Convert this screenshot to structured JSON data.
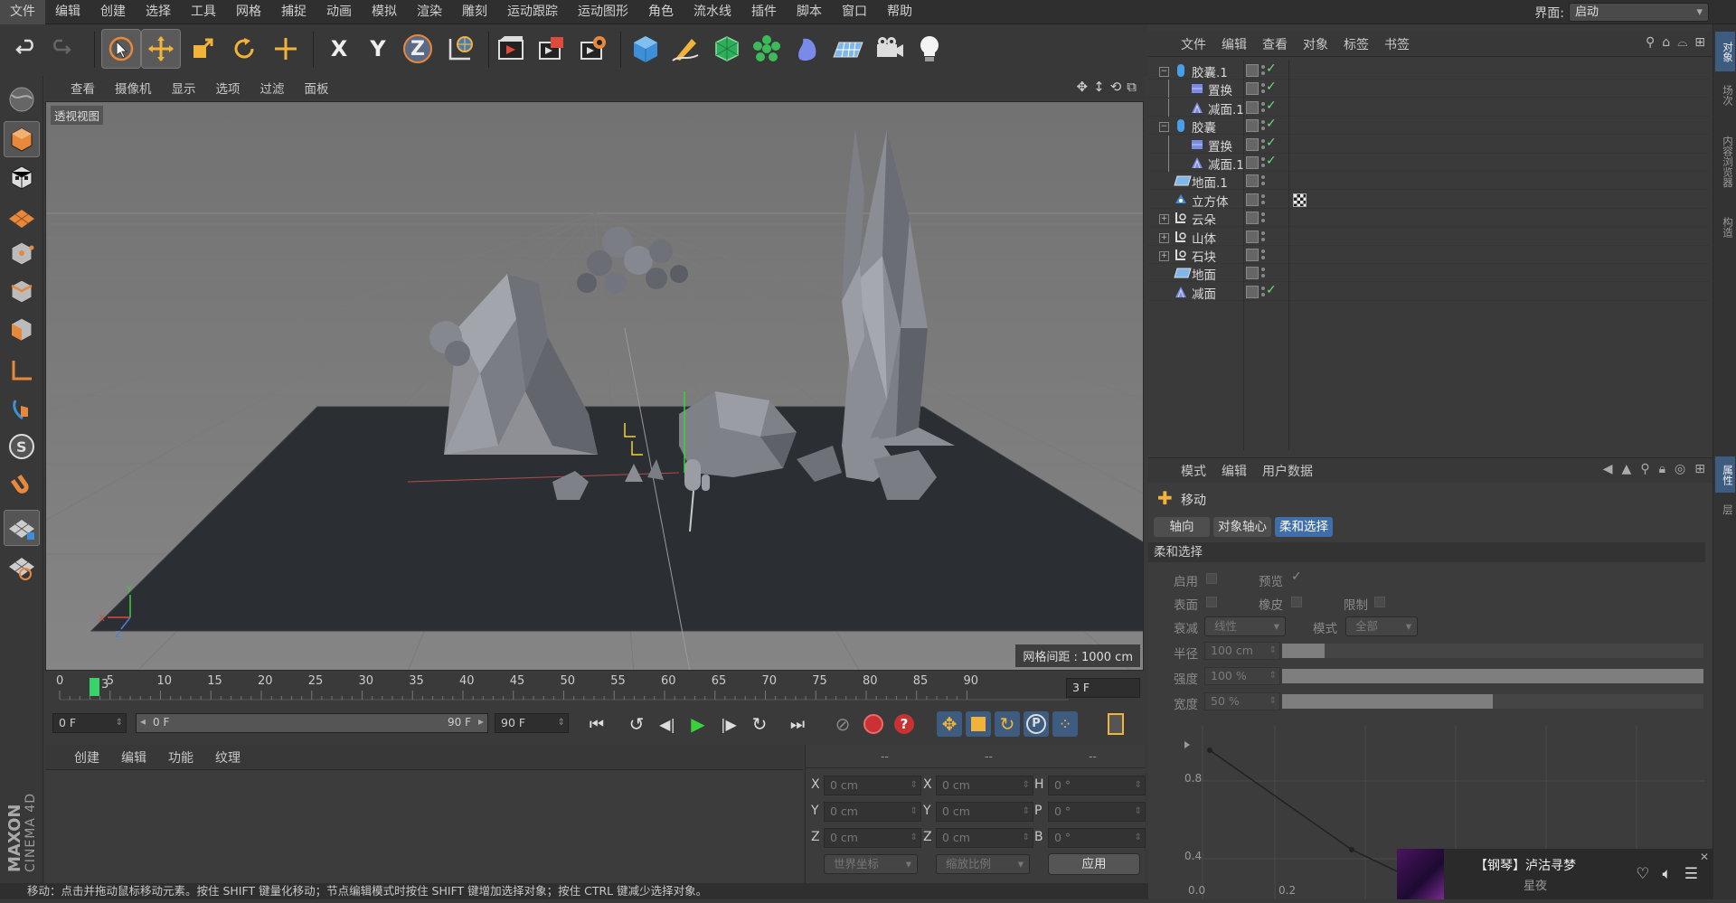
{
  "menubar": {
    "items": [
      "文件",
      "编辑",
      "创建",
      "选择",
      "工具",
      "网格",
      "捕捉",
      "动画",
      "模拟",
      "渲染",
      "雕刻",
      "运动跟踪",
      "运动图形",
      "角色",
      "流水线",
      "插件",
      "脚本",
      "窗口",
      "帮助"
    ],
    "layout_label": "界面:",
    "layout_value": "启动"
  },
  "toolbar": {
    "icons": [
      "undo-icon",
      "redo-icon",
      "live-select-icon",
      "move-icon",
      "scale-icon",
      "rotate-icon",
      "recent-tool-icon",
      "x-axis-icon",
      "y-axis-icon",
      "z-axis-icon",
      "coordinate-system-icon",
      "render-view-icon",
      "render-picture-viewer-icon",
      "render-settings-icon",
      "cube-primitive-icon",
      "pen-spline-icon",
      "subdivision-icon",
      "cloner-icon",
      "deformer-icon",
      "floor-icon",
      "camera-icon",
      "light-icon"
    ],
    "axis_x": "X",
    "axis_y": "Y",
    "axis_z": "Z"
  },
  "viewport": {
    "menu": [
      "查看",
      "摄像机",
      "显示",
      "选项",
      "过滤",
      "面板"
    ],
    "label": "透视视图",
    "grid_spacing": "网格间距 : 1000 cm"
  },
  "timeline": {
    "ticks": [
      "0",
      "5",
      "10",
      "15",
      "20",
      "25",
      "30",
      "35",
      "40",
      "45",
      "50",
      "55",
      "60",
      "65",
      "70",
      "75",
      "80",
      "85",
      "90"
    ],
    "current_frame_label": "3",
    "frame_field": "3 F",
    "start_field": "0 F",
    "range_start": "0 F",
    "range_end": "90 F",
    "end_field": "90 F"
  },
  "material": {
    "menu": [
      "创建",
      "编辑",
      "功能",
      "纹理"
    ]
  },
  "coords": {
    "headers": [
      "--",
      "--",
      "--"
    ],
    "rows": [
      {
        "a": "X",
        "v1": "0 cm",
        "b": "X",
        "v2": "0 cm",
        "c": "H",
        "v3": "0 °"
      },
      {
        "a": "Y",
        "v1": "0 cm",
        "b": "Y",
        "v2": "0 cm",
        "c": "P",
        "v3": "0 °"
      },
      {
        "a": "Z",
        "v1": "0 cm",
        "b": "Z",
        "v2": "0 cm",
        "c": "B",
        "v3": "0 °"
      }
    ],
    "world": "世界坐标",
    "scale": "缩放比例",
    "apply": "应用"
  },
  "status": "移动：点击并拖动鼠标移动元素。按住 SHIFT 键量化移动；节点编辑模式时按住 SHIFT 键增加选择对象；按住 CTRL 键减少选择对象。",
  "objects": {
    "menu": [
      "文件",
      "编辑",
      "查看",
      "对象",
      "标签",
      "书签"
    ],
    "rows": [
      {
        "name": "胶囊.1",
        "indent": 0,
        "tree": "⊟",
        "icon": "capsule",
        "check": true
      },
      {
        "name": "置换",
        "indent": 1,
        "tree": "",
        "icon": "displacer",
        "check": true
      },
      {
        "name": "减面.1",
        "indent": 1,
        "tree": "",
        "icon": "reduction",
        "check": true
      },
      {
        "name": "胶囊",
        "indent": 0,
        "tree": "⊟",
        "icon": "capsule",
        "check": true
      },
      {
        "name": "置换",
        "indent": 1,
        "tree": "",
        "icon": "displacer",
        "check": true
      },
      {
        "name": "减面.1",
        "indent": 1,
        "tree": "",
        "icon": "reduction",
        "check": true
      },
      {
        "name": "地面.1",
        "indent": 0,
        "tree": "",
        "icon": "floor",
        "check": false
      },
      {
        "name": "立方体",
        "indent": 0,
        "tree": "",
        "icon": "cube",
        "check": false,
        "tag": true
      },
      {
        "name": "云朵",
        "indent": 0,
        "tree": "⊞",
        "icon": "null",
        "check": false
      },
      {
        "name": "山体",
        "indent": 0,
        "tree": "⊞",
        "icon": "null",
        "check": false
      },
      {
        "name": "石块",
        "indent": 0,
        "tree": "⊞",
        "icon": "null",
        "check": false
      },
      {
        "name": "地面",
        "indent": 0,
        "tree": "",
        "icon": "floor",
        "check": false
      },
      {
        "name": "减面",
        "indent": 0,
        "tree": "",
        "icon": "reduction",
        "check": true
      }
    ]
  },
  "attributes": {
    "menu": [
      "模式",
      "编辑",
      "用户数据"
    ],
    "tool": "移动",
    "tabs": [
      "轴向",
      "对象轴心",
      "柔和选择"
    ],
    "section": "柔和选择",
    "enable": "启用",
    "preview": "预览",
    "surface": "表面",
    "rubber": "橡皮",
    "restrict": "限制",
    "falloff_label": "衰减",
    "falloff_value": "线性",
    "mode_label": "模式",
    "mode_value": "全部",
    "radius_label": "半径",
    "radius_value": "100 cm",
    "strength_label": "强度",
    "strength_value": "100 %",
    "width_label": "宽度",
    "width_value": "50 %",
    "radius_fill": 0.1,
    "strength_fill": 1.0,
    "width_fill": 0.5,
    "curve_y_labels": [
      "0.8",
      "0.4"
    ],
    "curve_x_labels": [
      "0.0",
      "0.2"
    ]
  },
  "right_tabs": [
    "对象",
    "场次",
    "内容浏览器",
    "构造",
    "属性",
    "层"
  ],
  "music": {
    "title": "【钢琴】泸沽寻梦",
    "subtitle": "星夜"
  },
  "logo": {
    "brand": "MAXON",
    "product": "CINEMA 4D"
  }
}
